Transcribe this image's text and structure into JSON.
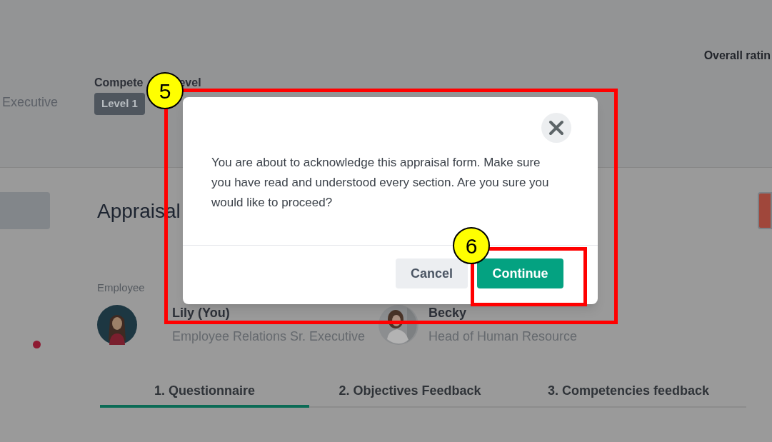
{
  "background": {
    "overall_rating_label": "Overall ratin",
    "executive_text": "Executive",
    "competency": {
      "label_parts": [
        "Compete",
        "evel"
      ],
      "badge": "Level 1"
    },
    "page_title": "Appraisal",
    "employee_label": "Employee",
    "people": [
      {
        "name": "Lily (You)",
        "role": "Employee Relations Sr. Executive",
        "kind": "illustration"
      },
      {
        "name": "Becky",
        "role": "Head of Human Resource",
        "kind": "picture"
      }
    ],
    "tabs": [
      {
        "label": "1. Questionnaire",
        "selected": true
      },
      {
        "label": "2. Objectives Feedback",
        "selected": false
      },
      {
        "label": "3. Competencies feedback",
        "selected": false
      }
    ]
  },
  "dialog": {
    "message": "You are about to acknowledge this appraisal form. Make sure you have read and understood every section. Are you sure you would like to proceed?",
    "buttons": [
      {
        "label": "Cancel",
        "kind": "secondary"
      },
      {
        "label": "Continue",
        "kind": "primary"
      }
    ]
  },
  "callouts": [
    {
      "number": "5"
    },
    {
      "number": "6"
    }
  ]
}
